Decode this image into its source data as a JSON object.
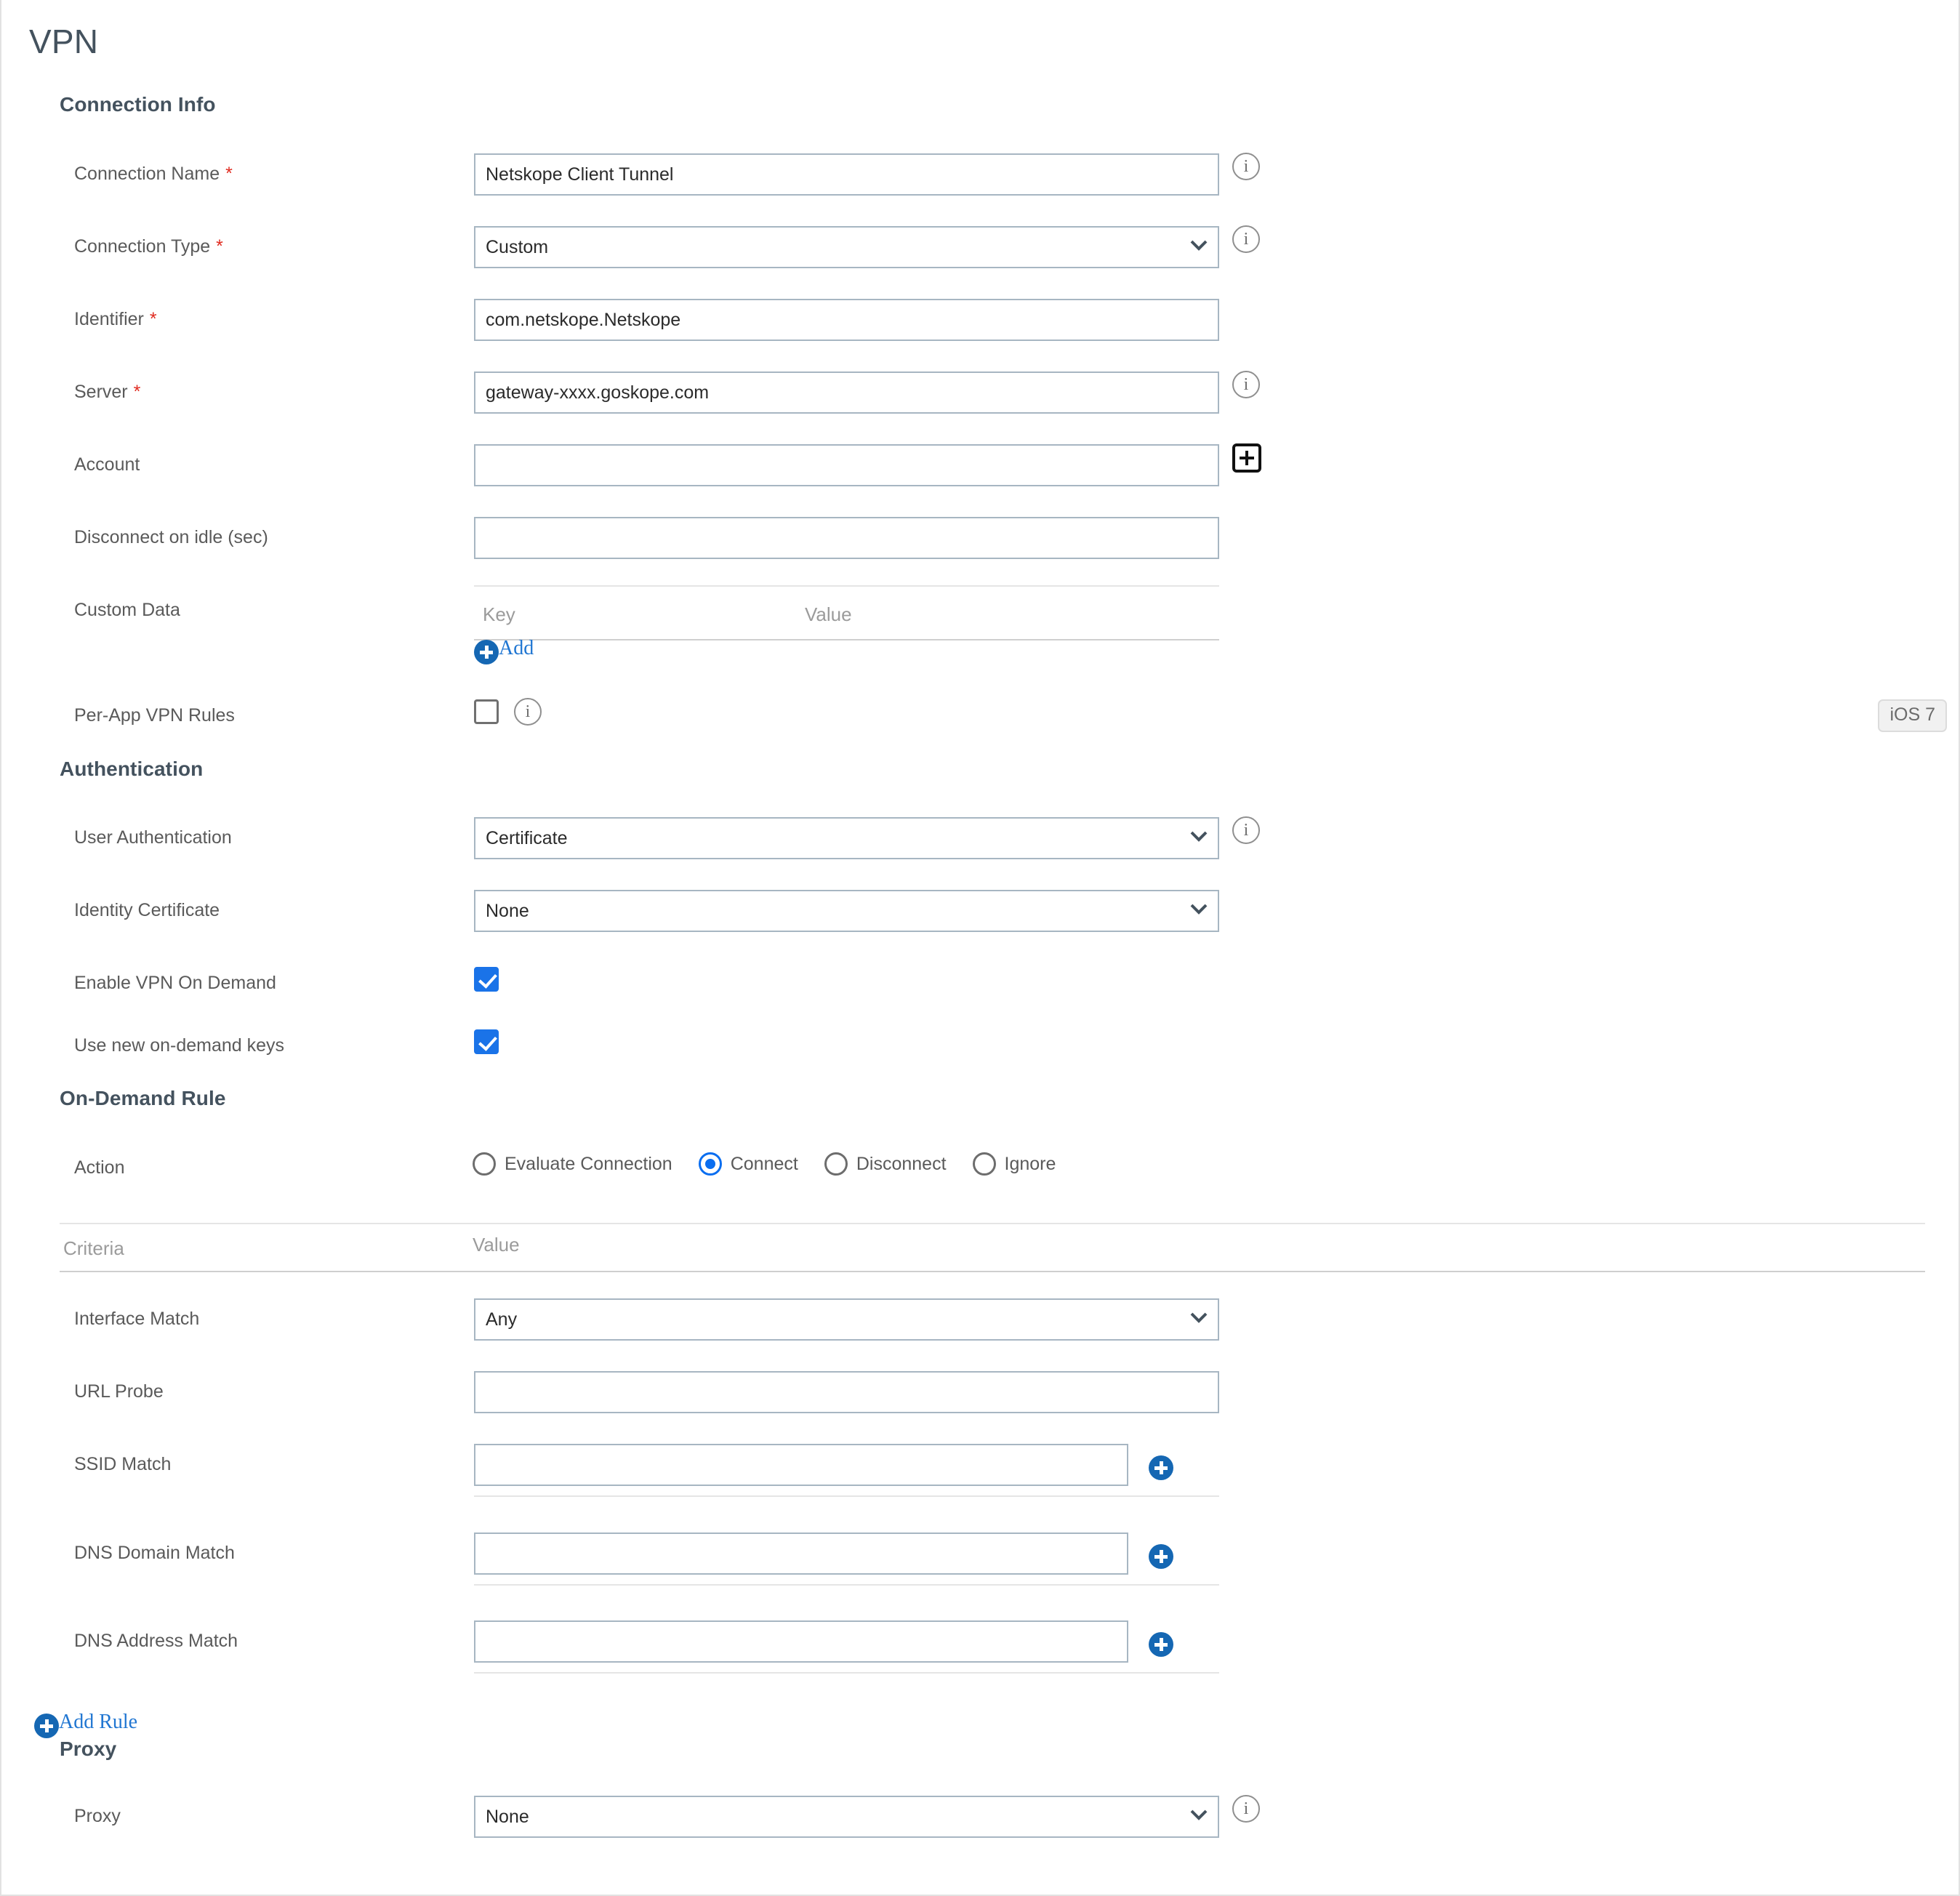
{
  "page": {
    "title": "VPN",
    "os_badge": "iOS 7"
  },
  "sections": {
    "connection_info": "Connection Info",
    "authentication": "Authentication",
    "on_demand_rule": "On-Demand Rule",
    "proxy": "Proxy"
  },
  "connection_info": {
    "connection_name": {
      "label": "Connection Name",
      "required": "*",
      "value": "Netskope Client Tunnel"
    },
    "connection_type": {
      "label": "Connection Type",
      "required": "*",
      "value": "Custom"
    },
    "identifier": {
      "label": "Identifier",
      "required": "*",
      "value": "com.netskope.Netskope"
    },
    "server": {
      "label": "Server",
      "required": "*",
      "value": "gateway-xxxx.goskope.com"
    },
    "account": {
      "label": "Account",
      "value": ""
    },
    "disconnect_idle": {
      "label": "Disconnect on idle (sec)",
      "value": ""
    },
    "custom_data": {
      "label": "Custom Data",
      "columns": [
        "Key",
        "Value"
      ],
      "rows": [],
      "add_label": "Add"
    },
    "per_app_vpn": {
      "label": "Per-App VPN Rules",
      "checked": false
    }
  },
  "authentication": {
    "user_authentication": {
      "label": "User Authentication",
      "value": "Certificate"
    },
    "identity_certificate": {
      "label": "Identity Certificate",
      "value": "None"
    },
    "enable_vpn_on_demand": {
      "label": "Enable VPN On Demand",
      "checked": true
    },
    "use_new_on_demand_keys": {
      "label": "Use new on-demand keys",
      "checked": true
    }
  },
  "on_demand_rule": {
    "action": {
      "label": "Action",
      "options": [
        "Evaluate Connection",
        "Connect",
        "Disconnect",
        "Ignore"
      ],
      "selected": "Connect"
    },
    "table_headers": {
      "criteria": "Criteria",
      "value": "Value"
    },
    "criteria": [
      {
        "label": "Interface Match",
        "type": "select",
        "value": "Any",
        "add": false
      },
      {
        "label": "URL Probe",
        "type": "text",
        "value": "",
        "add": false
      },
      {
        "label": "SSID Match",
        "type": "text",
        "value": "",
        "add": true
      },
      {
        "label": "DNS Domain Match",
        "type": "text",
        "value": "",
        "add": true
      },
      {
        "label": "DNS Address Match",
        "type": "text",
        "value": "",
        "add": true
      }
    ],
    "add_rule_label": "Add  Rule"
  },
  "proxy": {
    "proxy_field": {
      "label": "Proxy",
      "value": "None"
    }
  },
  "colors": {
    "accent_blue": "#1567b3",
    "link_blue": "#2076d2",
    "checkbox_blue": "#1a73e8",
    "radio_blue": "#0a6ef0",
    "required_red": "#e02b20",
    "heading": "#44525e",
    "field_border": "#a7b6c2"
  },
  "icons": {
    "info": "i",
    "chevron_down": "⌄",
    "plus": "+"
  }
}
